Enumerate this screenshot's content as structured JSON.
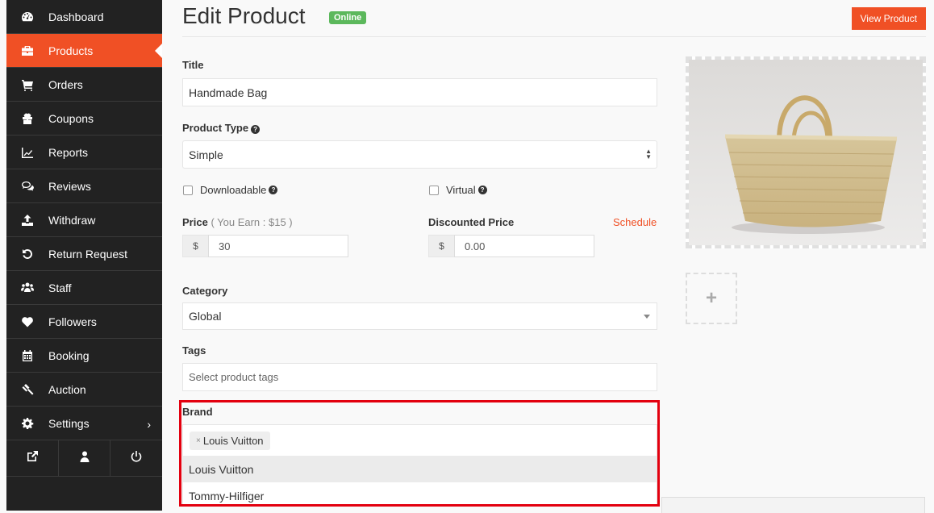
{
  "sidebar": {
    "items": [
      {
        "label": "Dashboard",
        "icon": "dashboard-icon",
        "active": false
      },
      {
        "label": "Products",
        "icon": "briefcase-icon",
        "active": true
      },
      {
        "label": "Orders",
        "icon": "cart-icon",
        "active": false
      },
      {
        "label": "Coupons",
        "icon": "gift-icon",
        "active": false
      },
      {
        "label": "Reports",
        "icon": "chart-line-icon",
        "active": false
      },
      {
        "label": "Reviews",
        "icon": "comments-icon",
        "active": false
      },
      {
        "label": "Withdraw",
        "icon": "upload-icon",
        "active": false
      },
      {
        "label": "Return Request",
        "icon": "undo-icon",
        "active": false
      },
      {
        "label": "Staff",
        "icon": "users-icon",
        "active": false
      },
      {
        "label": "Followers",
        "icon": "heart-icon",
        "active": false
      },
      {
        "label": "Booking",
        "icon": "calendar-icon",
        "active": false
      },
      {
        "label": "Auction",
        "icon": "gavel-icon",
        "active": false
      },
      {
        "label": "Settings",
        "icon": "gear-icon",
        "active": false,
        "chevron": "›"
      }
    ],
    "bottom_icons": [
      "external-link-icon",
      "user-icon",
      "power-icon"
    ]
  },
  "header": {
    "title": "Edit Product",
    "status_badge": "Online",
    "view_button": "View Product"
  },
  "form": {
    "title_label": "Title",
    "title_value": "Handmade Bag",
    "product_type_label": "Product Type",
    "product_type_value": "Simple",
    "downloadable_label": "Downloadable",
    "downloadable_checked": false,
    "virtual_label": "Virtual",
    "virtual_checked": false,
    "price_label": "Price",
    "price_earn_note": "( You Earn : $15 )",
    "price_prefix": "$",
    "price_value": "30",
    "discount_label": "Discounted Price",
    "schedule_link": "Schedule",
    "discount_prefix": "$",
    "discount_placeholder": "0.00",
    "category_label": "Category",
    "category_value": "Global",
    "tags_label": "Tags",
    "tags_placeholder": "Select product tags",
    "brand_label": "Brand",
    "brand_selected": [
      {
        "label": "Louis Vuitton",
        "remove": "×"
      }
    ],
    "brand_options": [
      {
        "label": "Louis Vuitton",
        "highlighted": true
      },
      {
        "label": "Tommy-Hilfiger",
        "highlighted": false
      }
    ]
  },
  "media": {
    "add_image": "+"
  },
  "colors": {
    "accent": "#f05025",
    "sidebar_bg": "#222222",
    "badge_green": "#5cb85c",
    "highlight_red": "#e3000f"
  }
}
